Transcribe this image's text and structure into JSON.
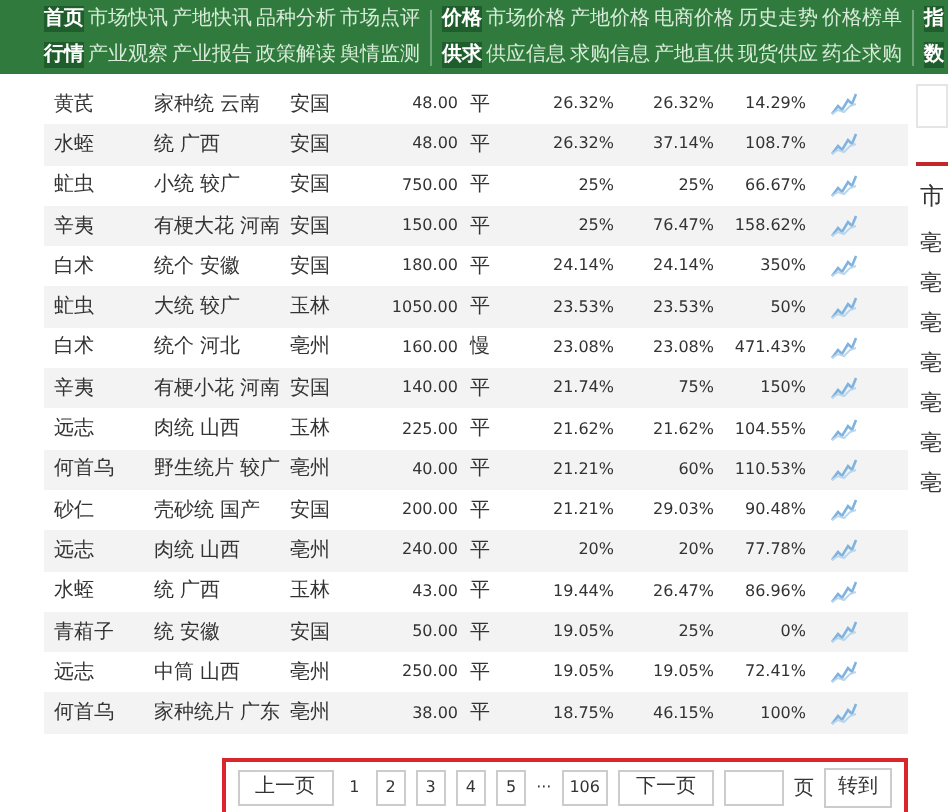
{
  "nav": [
    {
      "labels": [
        "首页",
        "行情"
      ],
      "links": [
        [
          "市场快讯",
          "产地快讯",
          "品种分析",
          "市场点评"
        ],
        [
          "产业观察",
          "产业报告",
          "政策解读",
          "舆情监测"
        ]
      ]
    },
    {
      "labels": [
        "价格",
        "供求"
      ],
      "links": [
        [
          "市场价格",
          "产地价格",
          "电商价格",
          "历史走势",
          "价格榜单"
        ],
        [
          "供应信息",
          "求购信息",
          "产地直供",
          "现货供应",
          "药企求购"
        ]
      ]
    },
    {
      "labels": [
        "指",
        "数"
      ]
    }
  ],
  "rows": [
    {
      "name": "黄芪",
      "spec": "家种统 云南",
      "market": "安国",
      "price": "48.00",
      "trend": "平",
      "change_1": "26.32%",
      "change_2": "26.32%",
      "change_3": "14.29%"
    },
    {
      "name": "水蛭",
      "spec": "统 广西",
      "market": "安国",
      "price": "48.00",
      "trend": "平",
      "change_1": "26.32%",
      "change_2": "37.14%",
      "change_3": "108.7%"
    },
    {
      "name": "虻虫",
      "spec": "小统 较广",
      "market": "安国",
      "price": "750.00",
      "trend": "平",
      "change_1": "25%",
      "change_2": "25%",
      "change_3": "66.67%"
    },
    {
      "name": "辛夷",
      "spec": "有梗大花 河南",
      "market": "安国",
      "price": "150.00",
      "trend": "平",
      "change_1": "25%",
      "change_2": "76.47%",
      "change_3": "158.62%"
    },
    {
      "name": "白术",
      "spec": "统个 安徽",
      "market": "安国",
      "price": "180.00",
      "trend": "平",
      "change_1": "24.14%",
      "change_2": "24.14%",
      "change_3": "350%"
    },
    {
      "name": "虻虫",
      "spec": "大统 较广",
      "market": "玉林",
      "price": "1050.00",
      "trend": "平",
      "change_1": "23.53%",
      "change_2": "23.53%",
      "change_3": "50%"
    },
    {
      "name": "白术",
      "spec": "统个 河北",
      "market": "亳州",
      "price": "160.00",
      "trend": "慢",
      "change_1": "23.08%",
      "change_2": "23.08%",
      "change_3": "471.43%"
    },
    {
      "name": "辛夷",
      "spec": "有梗小花 河南",
      "market": "安国",
      "price": "140.00",
      "trend": "平",
      "change_1": "21.74%",
      "change_2": "75%",
      "change_3": "150%"
    },
    {
      "name": "远志",
      "spec": "肉统 山西",
      "market": "玉林",
      "price": "225.00",
      "trend": "平",
      "change_1": "21.62%",
      "change_2": "21.62%",
      "change_3": "104.55%"
    },
    {
      "name": "何首乌",
      "spec": "野生统片 较广",
      "market": "亳州",
      "price": "40.00",
      "trend": "平",
      "change_1": "21.21%",
      "change_2": "60%",
      "change_3": "110.53%"
    },
    {
      "name": "砂仁",
      "spec": "壳砂统 国产",
      "market": "安国",
      "price": "200.00",
      "trend": "平",
      "change_1": "21.21%",
      "change_2": "29.03%",
      "change_3": "90.48%"
    },
    {
      "name": "远志",
      "spec": "肉统 山西",
      "market": "亳州",
      "price": "240.00",
      "trend": "平",
      "change_1": "20%",
      "change_2": "20%",
      "change_3": "77.78%"
    },
    {
      "name": "水蛭",
      "spec": "统 广西",
      "market": "玉林",
      "price": "43.00",
      "trend": "平",
      "change_1": "19.44%",
      "change_2": "26.47%",
      "change_3": "86.96%"
    },
    {
      "name": "青葙子",
      "spec": "统 安徽",
      "market": "安国",
      "price": "50.00",
      "trend": "平",
      "change_1": "19.05%",
      "change_2": "25%",
      "change_3": "0%"
    },
    {
      "name": "远志",
      "spec": "中筒 山西",
      "market": "亳州",
      "price": "250.00",
      "trend": "平",
      "change_1": "19.05%",
      "change_2": "19.05%",
      "change_3": "72.41%"
    },
    {
      "name": "何首乌",
      "spec": "家种统片 广东",
      "market": "亳州",
      "price": "38.00",
      "trend": "平",
      "change_1": "18.75%",
      "change_2": "46.15%",
      "change_3": "100%"
    }
  ],
  "pagination": {
    "prev": "上一页",
    "pages": [
      {
        "label": "1",
        "selected": true
      },
      {
        "label": "2",
        "selected": false
      },
      {
        "label": "3",
        "selected": false
      },
      {
        "label": "4",
        "selected": false
      },
      {
        "label": "5",
        "selected": false
      }
    ],
    "ellipsis": "···",
    "last": "106",
    "next": "下一页",
    "page_unit": "页",
    "go": "转到"
  },
  "side_panel": {
    "title": "市",
    "items": [
      "亳",
      "亳",
      "亳",
      "亳",
      "亳",
      "亳",
      "亳"
    ]
  }
}
